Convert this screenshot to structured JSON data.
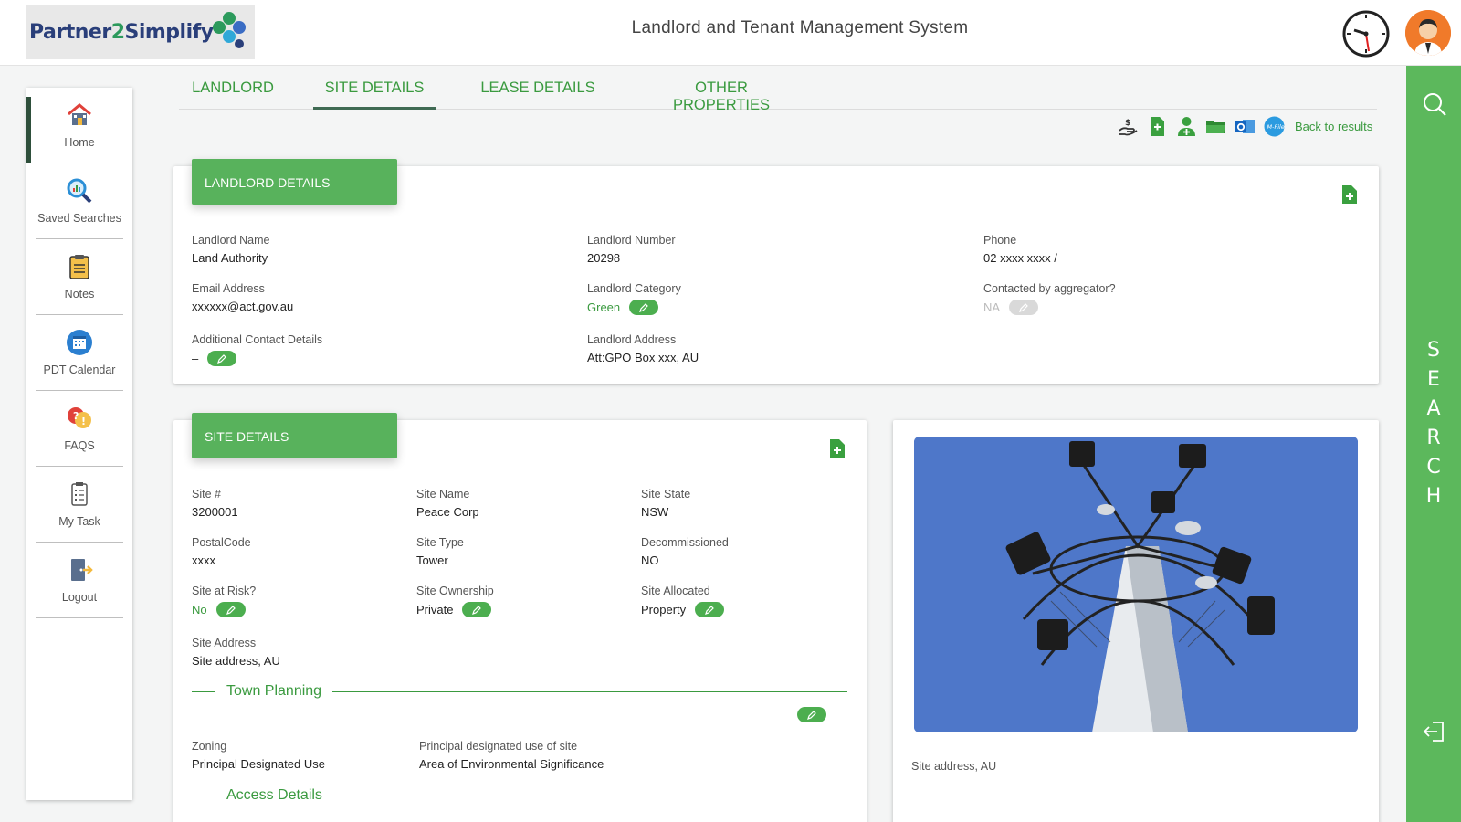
{
  "header": {
    "logo_text_a": "Partner",
    "logo_text_b": "2",
    "logo_text_c": "Simplify",
    "title": "Landlord and Tenant Management System"
  },
  "nav": {
    "items": [
      {
        "label": "Home",
        "icon": "home-icon"
      },
      {
        "label": "Saved Searches",
        "icon": "saved-searches-icon"
      },
      {
        "label": "Notes",
        "icon": "clipboard-icon"
      },
      {
        "label": "PDT Calendar",
        "icon": "calendar-icon"
      },
      {
        "label": "FAQS",
        "icon": "faq-icon"
      },
      {
        "label": "My Task",
        "icon": "task-icon"
      },
      {
        "label": "Logout",
        "icon": "logout-icon"
      }
    ],
    "active": "Home"
  },
  "tabs": [
    {
      "label": "LANDLORD"
    },
    {
      "label": "SITE DETAILS"
    },
    {
      "label": "LEASE DETAILS"
    },
    {
      "label": "OTHER PROPERTIES"
    }
  ],
  "active_tab": "SITE DETAILS",
  "toolbar": {
    "icons": [
      "handover-icon",
      "add-document-icon",
      "person-icon",
      "folder-icon",
      "outlook-icon",
      "mfiles-icon"
    ],
    "back_link": "Back to results"
  },
  "search_rail": {
    "letters": [
      "S",
      "E",
      "A",
      "R",
      "C",
      "H"
    ]
  },
  "landlord_card": {
    "title": "LANDLORD DETAILS",
    "landlord_name_label": "Landlord Name",
    "landlord_name": "Land Authority",
    "landlord_number_label": "Landlord Number",
    "landlord_number": "20298",
    "phone_label": "Phone",
    "phone": "02 xxxx xxxx /",
    "email_label": "Email Address",
    "email": "xxxxxx@act.gov.au",
    "category_label": "Landlord Category",
    "category": "Green",
    "aggregator_label": "Contacted by aggregator?",
    "aggregator": "NA",
    "additional_label": "Additional Contact Details",
    "additional": "–",
    "address_label": "Landlord Address",
    "address": "Att:GPO Box xxx, AU"
  },
  "site_card": {
    "title": "SITE DETAILS",
    "site_no_label": "Site #",
    "site_no": "3200001",
    "site_name_label": "Site Name",
    "site_name": "Peace Corp",
    "site_state_label": "Site State",
    "site_state": "NSW",
    "postal_label": "PostalCode",
    "postal": "xxxx",
    "site_type_label": "Site Type",
    "site_type": "Tower",
    "decom_label": "Decommissioned",
    "decom": "NO",
    "risk_label": "Site at Risk?",
    "risk": "No",
    "ownership_label": "Site Ownership",
    "ownership": "Private",
    "allocated_label": "Site Allocated",
    "allocated": "Property",
    "address_label": "Site Address",
    "address": "Site address, AU",
    "town_planning": "Town Planning",
    "zoning_label": "Zoning",
    "zoning": "Principal Designated Use",
    "principal_label": "Principal designated use of site",
    "principal": "Area of Environmental Significance",
    "access_details": "Access Details"
  },
  "photo_card": {
    "caption": "Site address, AU"
  },
  "colors": {
    "accent_green": "#5cb85c",
    "text_green": "#3a9a3f",
    "nav_active": "#2e4f3b",
    "photo_sky": "#4e77c9"
  }
}
